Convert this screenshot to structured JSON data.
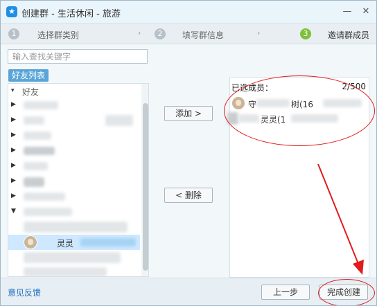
{
  "window": {
    "title": "创建群 - 生活休闲 - 旅游"
  },
  "steps": [
    {
      "num": "1",
      "label": "选择群类别"
    },
    {
      "num": "2",
      "label": "填写群信息"
    },
    {
      "num": "3",
      "label": "邀请群成员"
    }
  ],
  "step_arrow": "›",
  "search": {
    "placeholder": "输入查找关键字"
  },
  "tabs": {
    "friends": "好友列表"
  },
  "tree": {
    "first_group_label": "好友",
    "selected_friend_name": "灵灵"
  },
  "buttons": {
    "add": "添加 >",
    "remove": "< 删除",
    "prev": "上一步",
    "finish": "完成创建"
  },
  "selected": {
    "label": "已选成员：",
    "count": "2/500",
    "members": [
      {
        "name_prefix": "守",
        "name_suffix": "树(16"
      },
      {
        "name": "灵灵(1"
      }
    ]
  },
  "footer": {
    "feedback": "意见反馈"
  },
  "colors": {
    "annotation": "#e11c1c",
    "active_step": "#7fbf3a",
    "accent": "#1f8fe5"
  }
}
